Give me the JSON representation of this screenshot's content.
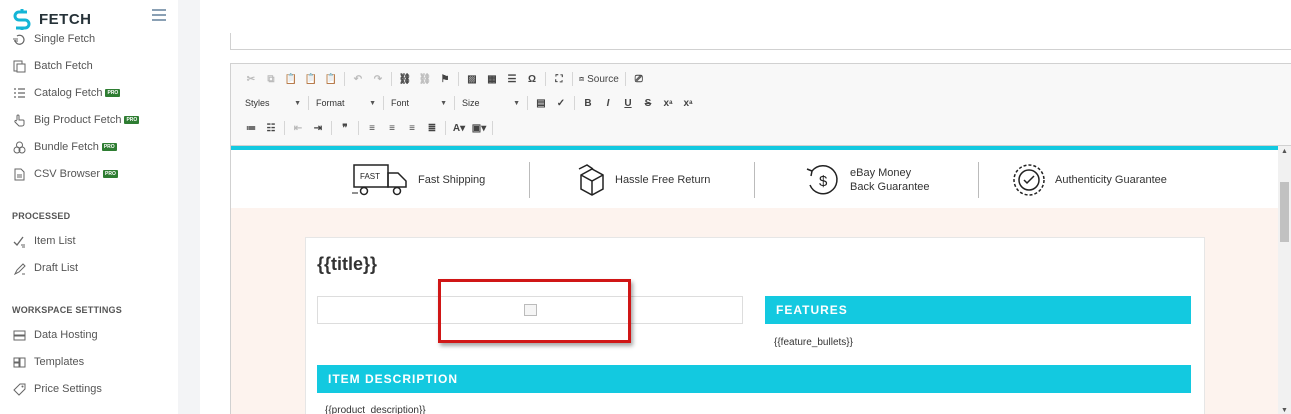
{
  "app": {
    "name": "FETCH"
  },
  "sidebar": {
    "items_top": [
      {
        "label": "Single Fetch",
        "icon": "single-fetch-icon",
        "pro": false
      },
      {
        "label": "Batch Fetch",
        "icon": "batch-fetch-icon",
        "pro": false
      },
      {
        "label": "Catalog Fetch",
        "icon": "catalog-list-icon",
        "pro": true
      },
      {
        "label": "Big Product Fetch",
        "icon": "hand-pointer-icon",
        "pro": true
      },
      {
        "label": "Bundle Fetch",
        "icon": "bundle-icon",
        "pro": true
      },
      {
        "label": "CSV Browser",
        "icon": "csv-file-icon",
        "pro": true
      }
    ],
    "pro_label": "PRO",
    "sections": [
      {
        "title": "PROCESSED",
        "items": [
          {
            "label": "Item List",
            "icon": "item-list-icon"
          },
          {
            "label": "Draft List",
            "icon": "draft-list-icon"
          }
        ]
      },
      {
        "title": "WORKSPACE SETTINGS",
        "items": [
          {
            "label": "Data Hosting",
            "icon": "data-hosting-icon"
          },
          {
            "label": "Templates",
            "icon": "templates-icon"
          },
          {
            "label": "Price Settings",
            "icon": "price-settings-icon"
          }
        ]
      }
    ]
  },
  "toolbar": {
    "source_label": "Source",
    "styles_label": "Styles",
    "format_label": "Format",
    "font_label": "Font",
    "size_label": "Size"
  },
  "template": {
    "badges": {
      "fast_icon_text": "FAST",
      "shipping": "Fast Shipping",
      "return": "Hassle Free Return",
      "money_line1": "eBay Money",
      "money_line2": "Back Guarantee",
      "authenticity": "Authenticity Guarantee"
    },
    "title_placeholder": "{{title}}",
    "features_heading": "FEATURES",
    "feature_bullets": "{{feature_bullets}}",
    "item_description_heading": "ITEM DESCRIPTION",
    "product_description": "{{product_description}}"
  },
  "colors": {
    "accent": "#13c9e0",
    "highlight": "#d01616",
    "content_bg": "#fdf3ee"
  }
}
